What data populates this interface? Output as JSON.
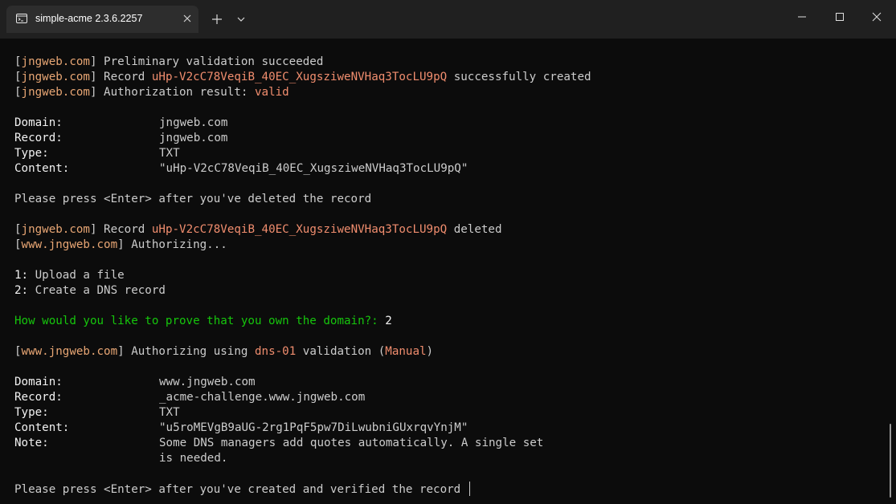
{
  "window": {
    "tab_title": "simple-acme 2.3.6.2257",
    "tab_icon": "terminal-icon",
    "controls": [
      "minimize-icon",
      "maximize-icon",
      "close-icon"
    ]
  },
  "terminal": {
    "l1_host": "jngweb.com",
    "l1_text": " Preliminary validation succeeded",
    "l2_host": "jngweb.com",
    "l2_pre": " Record ",
    "l2_record": "uHp-V2cC78VeqiB_40EC_XugsziweNVHaq3TocLU9pQ",
    "l2_post": " successfully created",
    "l3_host": "jngweb.com",
    "l3_text": " Authorization result: ",
    "l3_value": "valid",
    "block1": {
      "domain_label": "Domain:",
      "domain_value": "jngweb.com",
      "record_label": "Record:",
      "record_value": "jngweb.com",
      "type_label": "Type:",
      "type_value": "TXT",
      "content_label": "Content:",
      "content_value": "\"uHp-V2cC78VeqiB_40EC_XugsziweNVHaq3TocLU9pQ\""
    },
    "prompt_deleted": "Please press <Enter> after you've deleted the record",
    "l4_host": "jngweb.com",
    "l4_pre": " Record ",
    "l4_record": "uHp-V2cC78VeqiB_40EC_XugsziweNVHaq3TocLU9pQ",
    "l4_post": " deleted",
    "l5_host": "www.jngweb.com",
    "l5_text": " Authorizing...",
    "option1_num": "1:",
    "option1_text": " Upload a file",
    "option2_num": "2:",
    "option2_text": " Create a DNS record",
    "question": "How would you like to prove that you own the domain?:",
    "answer": "2",
    "l6_host": "www.jngweb.com",
    "l6_pre": " Authorizing using ",
    "l6_method": "dns-01",
    "l6_mid": " validation (",
    "l6_mode": "Manual",
    "l6_post": ")",
    "block2": {
      "domain_label": "Domain:",
      "domain_value": "www.jngweb.com",
      "record_label": "Record:",
      "record_value": "_acme-challenge.www.jngweb.com",
      "type_label": "Type:",
      "type_value": "TXT",
      "content_label": "Content:",
      "content_value": "\"u5roMEVgB9aUG-2rg1PqF5pw7DiLwubniGUxrqvYnjM\"",
      "note_label": "Note:",
      "note_value": "Some DNS managers add quotes automatically. A single set",
      "note_value_2": "is needed."
    },
    "prompt_created": "Please press <Enter> after you've created and verified the record"
  },
  "colors": {
    "background": "#0c0c0c",
    "text": "#cccccc",
    "host": "#e8a674",
    "highlight": "#f08d6e",
    "prompt": "#16c60c"
  }
}
